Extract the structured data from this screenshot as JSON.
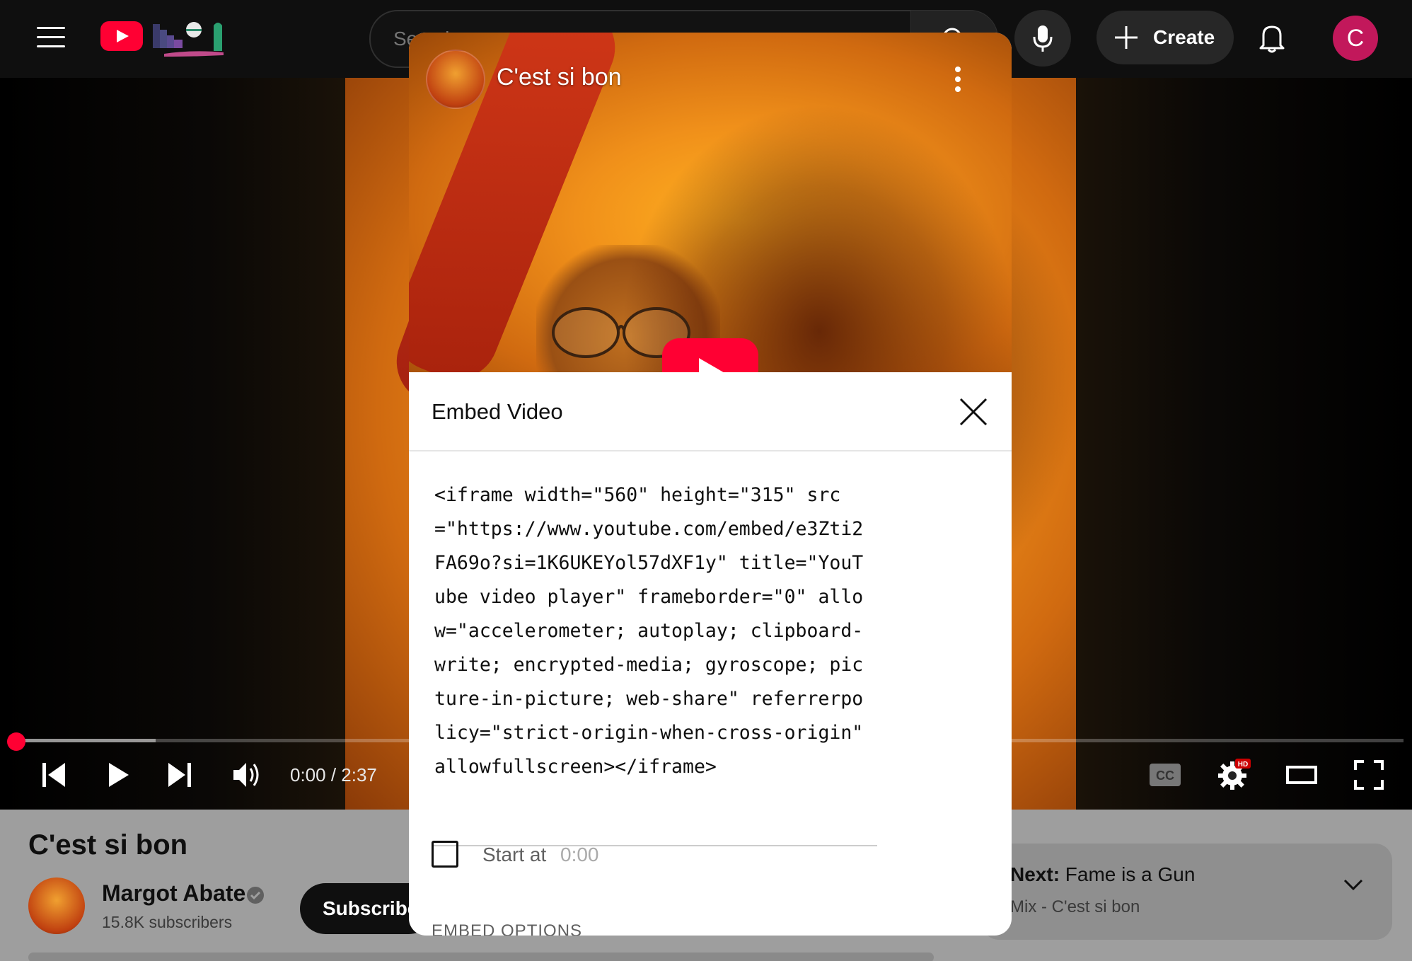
{
  "header": {
    "search_placeholder": "Search",
    "create_label": "Create",
    "avatar_letter": "C"
  },
  "player": {
    "current_time": "0:00",
    "duration": "2:37",
    "time_display": "0:00 / 2:37",
    "progress_fraction": 0.0,
    "buffered_fraction": 0.1,
    "hd_badge": "HD"
  },
  "video": {
    "title": "C'est si bon",
    "channel_name": "Margot Abate",
    "subscribers": "15.8K subscribers",
    "subscribe_label": "Subscribe"
  },
  "up_next": {
    "prefix": "Next:",
    "title": "Fame is a Gun",
    "subtitle": "Mix - C'est si bon"
  },
  "embed_modal": {
    "preview_title": "C'est si bon",
    "title": "Embed Video",
    "code": "<iframe width=\"560\" height=\"315\" src=\"https://www.youtube.com/embed/e3Zti2FA69o?si=1K6UKEYol57dXF1y\" title=\"YouTube video player\" frameborder=\"0\" allow=\"accelerometer; autoplay; clipboard-write; encrypted-media; gyroscope; picture-in-picture; web-share\" referrerpolicy=\"strict-origin-when-cross-origin\" allowfullscreen></iframe>",
    "start_at_label": "Start at",
    "start_at_value": "0:00",
    "embed_options_label": "EMBED OPTIONS"
  },
  "colors": {
    "brand_red": "#ff0033",
    "avatar_pink": "#c2185b",
    "page_bg": "#0f0f0f"
  }
}
